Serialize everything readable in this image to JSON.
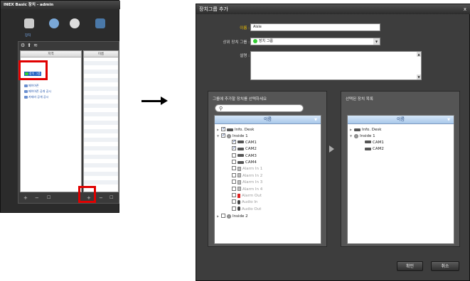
{
  "app": {
    "title": "INEX Basic 장치 - admin",
    "selected_section": "장치",
    "tree_header": "지역",
    "list_header": "이름",
    "tree_items": [
      "장치 그룹",
      "페이아존",
      "페이아존 공개 공시",
      "카테라 공개 공시"
    ],
    "bottom_tools": [
      "+",
      "−",
      "☐"
    ],
    "list_bottom_tools": [
      "+",
      "−",
      "☐"
    ]
  },
  "dialog": {
    "title": "장치그룹 추가",
    "close": "x",
    "name_label": "이름 :",
    "name_value": "Aisle",
    "parent_label": "상위 장치 그룹 :",
    "parent_value": "장치 그룹",
    "desc_label": "설명 :",
    "left_group_title": "그룹에 추가할 장치를 선택하세요",
    "right_group_title": "선택된 장치 목록",
    "list_header": "이름",
    "left_tree": [
      {
        "label": "Info. Desk",
        "icon": "camera-icon",
        "checked": true,
        "expander": "▶",
        "indent": 0,
        "disabled": false
      },
      {
        "label": "Inside 1",
        "icon": "group-icon",
        "checked": true,
        "expander": "▼",
        "indent": 0,
        "disabled": false
      },
      {
        "label": "CAM1",
        "icon": "camera-icon",
        "checked": true,
        "expander": "",
        "indent": 1,
        "disabled": false
      },
      {
        "label": "CAM2",
        "icon": "camera-icon",
        "checked": true,
        "expander": "",
        "indent": 1,
        "disabled": false
      },
      {
        "label": "CAM3",
        "icon": "camera-icon",
        "checked": false,
        "expander": "",
        "indent": 1,
        "disabled": false
      },
      {
        "label": "CAM4",
        "icon": "camera-icon",
        "checked": false,
        "expander": "",
        "indent": 1,
        "disabled": false
      },
      {
        "label": "Alarm In 1",
        "icon": "alarm-in-icon",
        "checked": false,
        "expander": "",
        "indent": 1,
        "disabled": true
      },
      {
        "label": "Alarm In 2",
        "icon": "alarm-in-icon",
        "checked": false,
        "expander": "",
        "indent": 1,
        "disabled": true
      },
      {
        "label": "Alarm In 3",
        "icon": "alarm-in-icon",
        "checked": false,
        "expander": "",
        "indent": 1,
        "disabled": true
      },
      {
        "label": "Alarm In 4",
        "icon": "alarm-in-icon",
        "checked": false,
        "expander": "",
        "indent": 1,
        "disabled": true
      },
      {
        "label": "Alarm Out",
        "icon": "alarm-out-icon",
        "checked": false,
        "expander": "",
        "indent": 1,
        "disabled": true
      },
      {
        "label": "Audio In",
        "icon": "audio-in-icon",
        "checked": false,
        "expander": "",
        "indent": 1,
        "disabled": true
      },
      {
        "label": "Audio Out",
        "icon": "audio-out-icon",
        "checked": false,
        "expander": "",
        "indent": 1,
        "disabled": true
      },
      {
        "label": "Inside 2",
        "icon": "group-icon",
        "checked": false,
        "expander": "▶",
        "indent": 0,
        "disabled": false
      }
    ],
    "right_tree": [
      {
        "label": "Info. Desk",
        "icon": "camera-icon",
        "expander": "▶",
        "indent": 0
      },
      {
        "label": "Inside 1",
        "icon": "group-icon",
        "expander": "▼",
        "indent": 0
      },
      {
        "label": "CAM1",
        "icon": "camera-icon",
        "expander": "",
        "indent": 1
      },
      {
        "label": "CAM2",
        "icon": "camera-icon",
        "expander": "",
        "indent": 1
      }
    ],
    "ok_label": "확인",
    "cancel_label": "취소"
  },
  "colors": {
    "highlight": "#e00000",
    "header_blue": "#a9c8ea"
  }
}
